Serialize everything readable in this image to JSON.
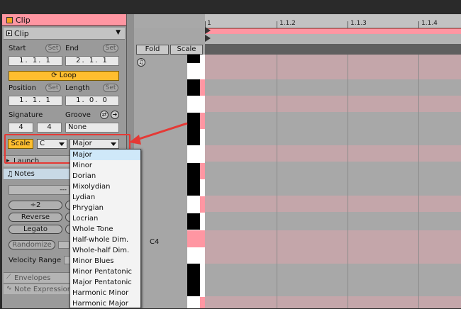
{
  "clip_panel": {
    "title": "Clip",
    "header_label": "Clip",
    "start_label": "Start",
    "end_label": "End",
    "set_label": "Set",
    "start_value": "1.  1.  1",
    "end_value": "2.  1.  1",
    "loop_label": "Loop",
    "position_label": "Position",
    "length_label": "Length",
    "position_value": "1.  1.  1",
    "length_value": "1.  0.  0",
    "signature_label": "Signature",
    "groove_label": "Groove",
    "sig_num": "4",
    "sig_den": "4",
    "groove_value": "None",
    "scale_button": "Scale",
    "scale_root": "C",
    "scale_type": "Major",
    "launch_label": "Launch",
    "notes_label": "Notes",
    "notes_dash": "---",
    "halve_label": "÷2",
    "reverse_label": "Reverse",
    "legato_label": "Legato",
    "randomize_label": "Randomize",
    "velocity_range_label": "Velocity Range",
    "envelopes_label": "Envelopes",
    "note_expression_label": "Note Expression"
  },
  "editor": {
    "fold_label": "Fold",
    "scale_label": "Scale",
    "ruler": [
      "1",
      "1.1.2",
      "1.1.3",
      "1.1.4"
    ],
    "c4_label": "C4"
  },
  "scale_menu": {
    "items": [
      "Major",
      "Minor",
      "Dorian",
      "Mixolydian",
      "Lydian",
      "Phrygian",
      "Locrian",
      "Whole Tone",
      "Half-whole Dim.",
      "Whole-half Dim.",
      "Minor Blues",
      "Minor Pentatonic",
      "Major Pentatonic",
      "Harmonic Minor",
      "Harmonic Major"
    ],
    "selected": "Major"
  },
  "colors": {
    "clip_pink": "#ff96a2",
    "accent_orange": "#ffbe2f",
    "highlight_red": "#e53935"
  }
}
